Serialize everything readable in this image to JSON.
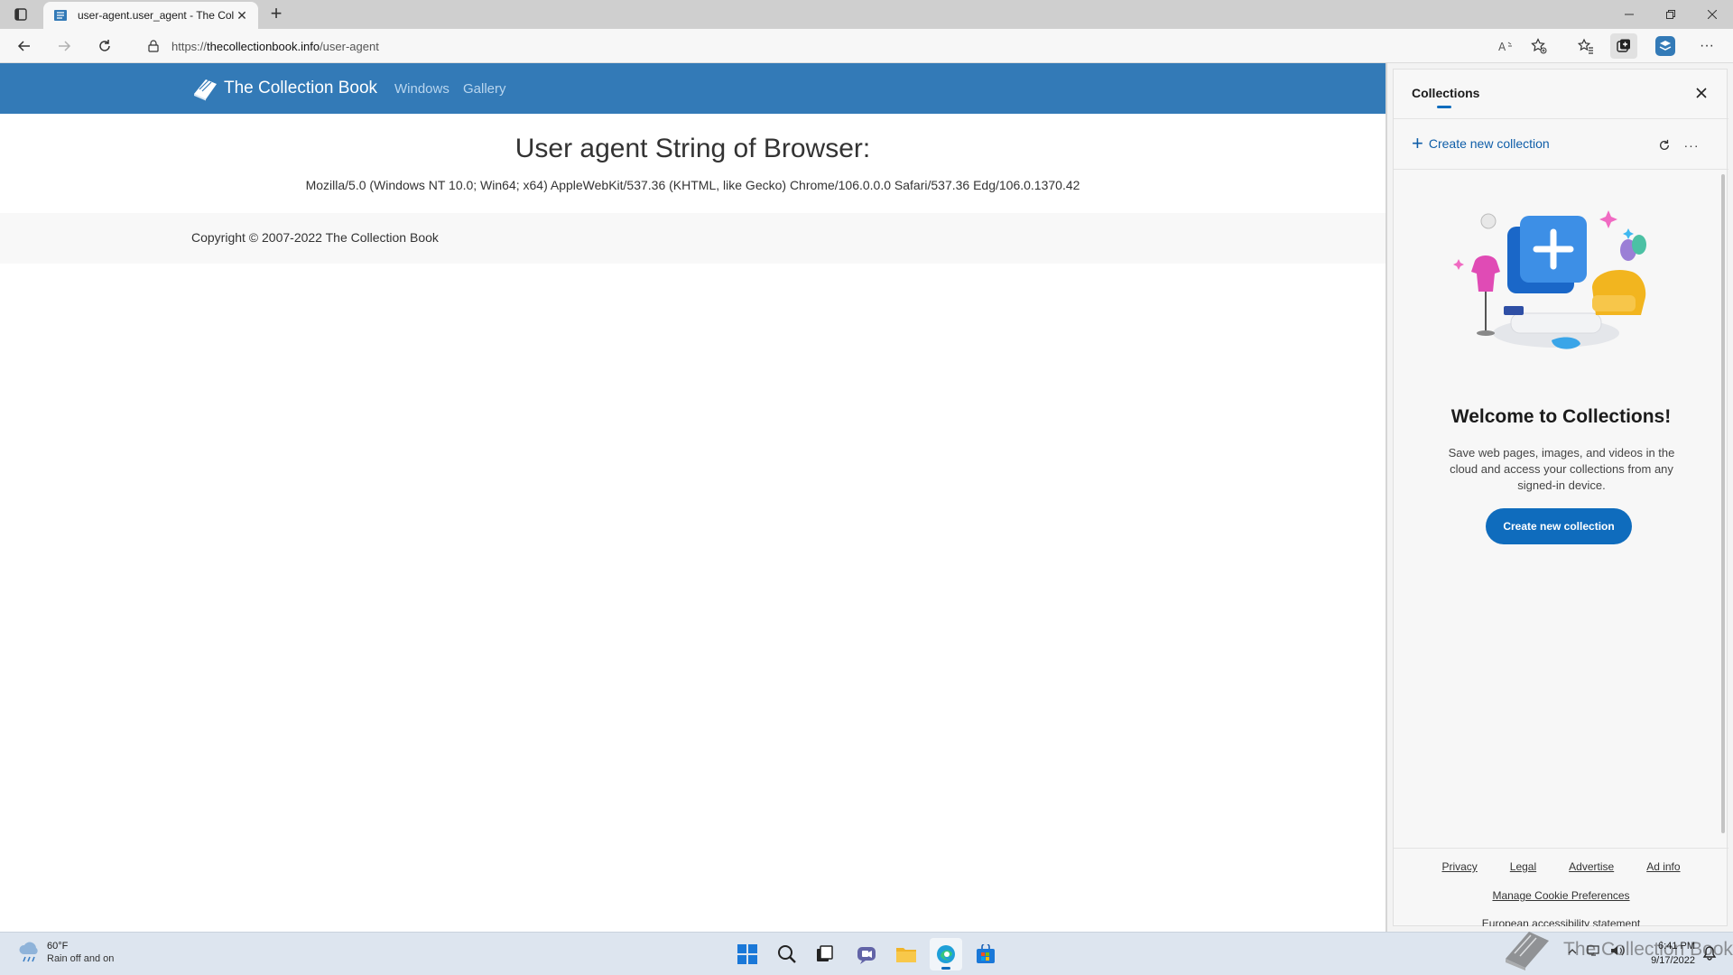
{
  "browser": {
    "tab": {
      "title": "user-agent.user_agent - The Coll"
    },
    "address": {
      "url_prefix": "https://",
      "url_domain": "thecollectionbook.info",
      "url_path": "/user-agent"
    }
  },
  "site": {
    "brand": "The Collection Book",
    "nav": [
      "Windows",
      "Gallery"
    ],
    "heading": "User agent String of Browser:",
    "user_agent": "Mozilla/5.0 (Windows NT 10.0; Win64; x64) AppleWebKit/537.36 (KHTML, like Gecko) Chrome/106.0.0.0 Safari/537.36 Edg/106.0.1370.42",
    "copyright": "Copyright © 2007-2022 The Collection Book",
    "header_color": "#337ab7"
  },
  "collections": {
    "title": "Collections",
    "create_link": "Create new collection",
    "welcome": "Welcome to Collections!",
    "description": "Save web pages, images, and videos in the cloud and access your collections from any signed-in device.",
    "cta": "Create new collection",
    "footer_links": [
      "Privacy",
      "Legal",
      "Advertise",
      "Ad info"
    ],
    "cookie": "Manage Cookie Preferences",
    "cut_link": "European accessibility statement",
    "accent": "#0f6cbd"
  },
  "taskbar": {
    "weather_temp": "60°F",
    "weather_cond": "Rain off and on",
    "watermark": "The Collection Book",
    "time": "6:41 PM",
    "date": "9/17/2022"
  }
}
